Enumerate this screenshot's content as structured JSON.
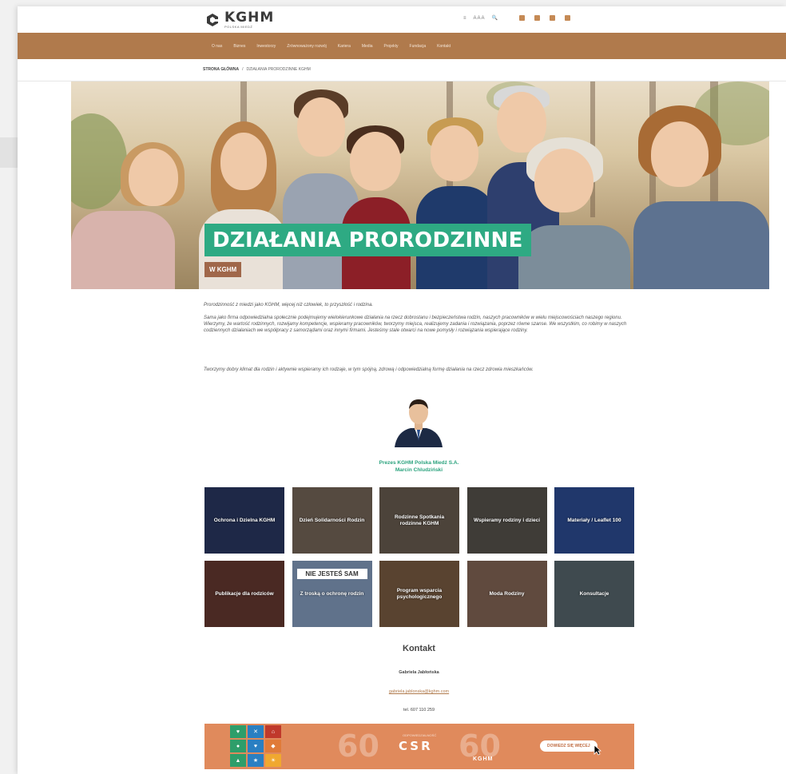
{
  "header": {
    "logo_name": "KGHM",
    "logo_sub": "POLSKA MIEDŹ",
    "utils": [
      "≡",
      "A A A",
      "🔍"
    ],
    "social_icons": [
      "facebook-icon",
      "linkedin-icon",
      "twitter-icon",
      "youtube-icon"
    ]
  },
  "nav": {
    "items": [
      "O nas",
      "Biznes",
      "Inwestorzy",
      "Zrównoważony rozwój",
      "Kariera",
      "Media",
      "Projekty",
      "Fundacja",
      "Kontakt"
    ]
  },
  "breadcrumb": {
    "home": "STRONA GŁÓWNA",
    "sep": "/",
    "current": "DZIAŁANIA PRORODZINNE KGHM"
  },
  "hero": {
    "title": "DZIAŁANIA PRORODZINNE",
    "badge": "W KGHM"
  },
  "content": {
    "p1": "Prorodzinność z miedzi jako KGHM, więcej niż człowiek, to przyszłość i rodzina.",
    "p2": "Sama jako firma odpowiedzialna społecznie podejmujemy wielokierunkowe działania na rzecz dobrostanu i bezpieczeństwa rodzin, naszych pracowników w wielu miejscowościach naszego regionu. Wierzymy, że wartość rodzinnych, rozwijamy kompetencje, wspieramy pracowników, tworzymy miejsca, realizujemy zadania i rozwiązania, poprzez równe szanse. We wszystkim, co robimy w naszych codziennych działaniach we współpracy z samorządami oraz innymi firmami. Jesteśmy stale otwarci na nowe pomysły i rozwiązania wspierające rodziny.",
    "p3": "Tworzymy dobry klimat dla rodzin i aktywnie wspieramy ich rodzaje, w tym spójną, zdrową i odpowiedzialną formę działania na rzecz zdrowia mieszkańców."
  },
  "ceo": {
    "line1": "Prezes KGHM Polska Miedź S.A.",
    "line2": "Marcin Chludziński"
  },
  "tiles": [
    {
      "label": "Ochrona i Dzielna KGHM",
      "bg": "#2b3a66"
    },
    {
      "label": "Dzień Solidarności Rodzin",
      "bg": "#7a6a5c"
    },
    {
      "label": "Rodzinne Spotkania rodzinne KGHM",
      "bg": "#6e6154"
    },
    {
      "label": "Wspieramy rodziny i dzieci",
      "bg": "#5b5650"
    },
    {
      "label": "Materiały / Leaflet 100",
      "bg": "#2f4f9a"
    },
    {
      "label": "Publikacje dla rodziców",
      "bg": "#6b3c33"
    },
    {
      "label": "Z troską o ochronę rodzin",
      "bg": "#8aa4c8"
    },
    {
      "label": "Program wsparcia psychologicznego",
      "bg": "#806046"
    },
    {
      "label": "Moda Rodziny",
      "bg": "#8a6a5a"
    },
    {
      "label": "Konsultacje",
      "bg": "#5b6a72"
    }
  ],
  "tile_headline": "NIE JESTEŚ SAM",
  "contact": {
    "title": "Kontakt",
    "name": "Gabriela Jabłońska",
    "email": "gabriela.jablonska@kghm.com",
    "phone": "tel. 607 110 259"
  },
  "banner": {
    "left_num": "60",
    "label_small": "ODPOWIEDZIALNOŚĆ",
    "csr": "CSR",
    "right_num": "60",
    "kghm": "KGHM",
    "button": "DOWIEDZ SIĘ WIĘCEJ"
  },
  "colors": {
    "nav_bg": "#b07a4c",
    "accent_green": "#2eaa83",
    "badge_brown": "#a0674a",
    "banner_bg": "#e08a5c"
  }
}
